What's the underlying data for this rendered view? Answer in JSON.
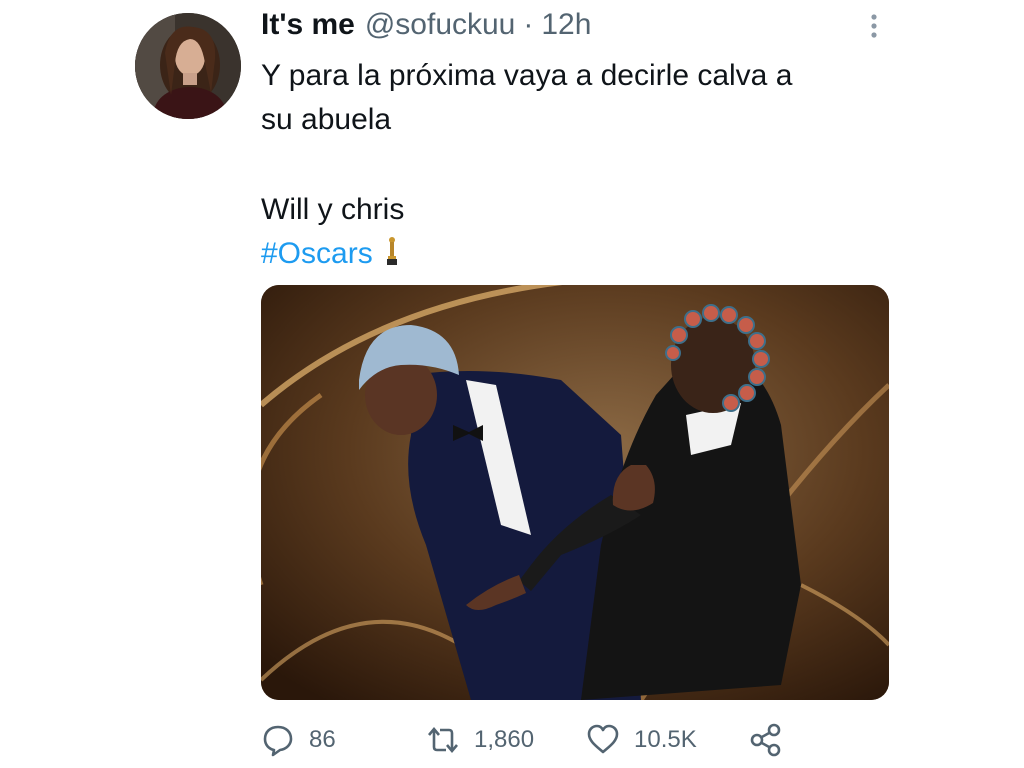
{
  "tweet": {
    "author": {
      "display_name": "It's me",
      "handle": "@sofuckuu",
      "separator": "·",
      "time": "12h"
    },
    "text": {
      "line1": "Y para la próxima vaya a decirle calva a",
      "line2": "su abuela",
      "line3": "Will y chris",
      "hashtag": "#Oscars"
    },
    "counts": {
      "replies": "86",
      "retweets": "1,860",
      "likes": "10.5K"
    },
    "colors": {
      "link": "#1d9bf0",
      "secondary": "#536471",
      "primary": "#0f1419"
    },
    "icons": [
      "more-icon",
      "reply-icon",
      "retweet-icon",
      "like-icon",
      "share-icon",
      "oscar-trophy-emoji"
    ]
  }
}
